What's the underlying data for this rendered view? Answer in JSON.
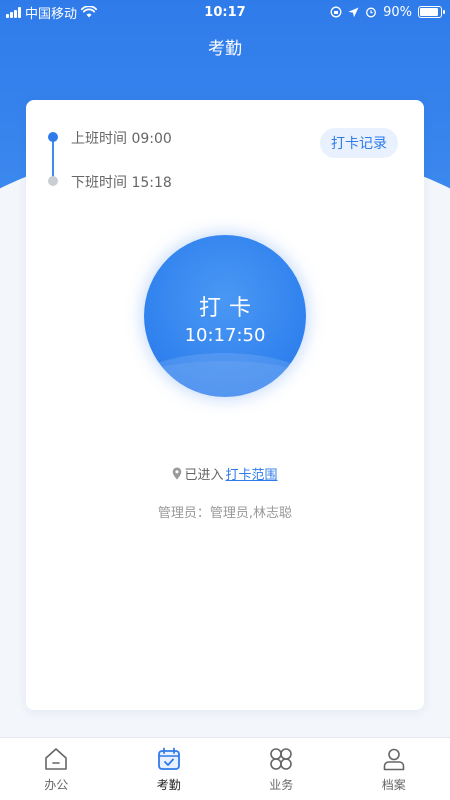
{
  "status_bar": {
    "carrier": "中国移动",
    "time": "10:17",
    "battery": "90%",
    "battery_level": 0.9
  },
  "header": {
    "title": "考勤"
  },
  "shifts": [
    {
      "label": "上班时间 09:00",
      "active": true
    },
    {
      "label": "下班时间 15:18",
      "active": false
    }
  ],
  "record_button": {
    "label": "打卡记录"
  },
  "punch": {
    "label": "打卡",
    "time": "10:17:50"
  },
  "location": {
    "prefix": "已进入",
    "link": "打卡范围"
  },
  "admin": {
    "text": "管理员：管理员,林志聪"
  },
  "tabs": [
    {
      "label": "办公",
      "icon": "home-icon",
      "active": false
    },
    {
      "label": "考勤",
      "icon": "calendar-check-icon",
      "active": true
    },
    {
      "label": "业务",
      "icon": "grid-icon",
      "active": false
    },
    {
      "label": "档案",
      "icon": "user-icon",
      "active": false
    }
  ],
  "colors": {
    "primary": "#2f7bea",
    "active_tab": "#2f7bea",
    "inactive_tab": "#666666"
  }
}
